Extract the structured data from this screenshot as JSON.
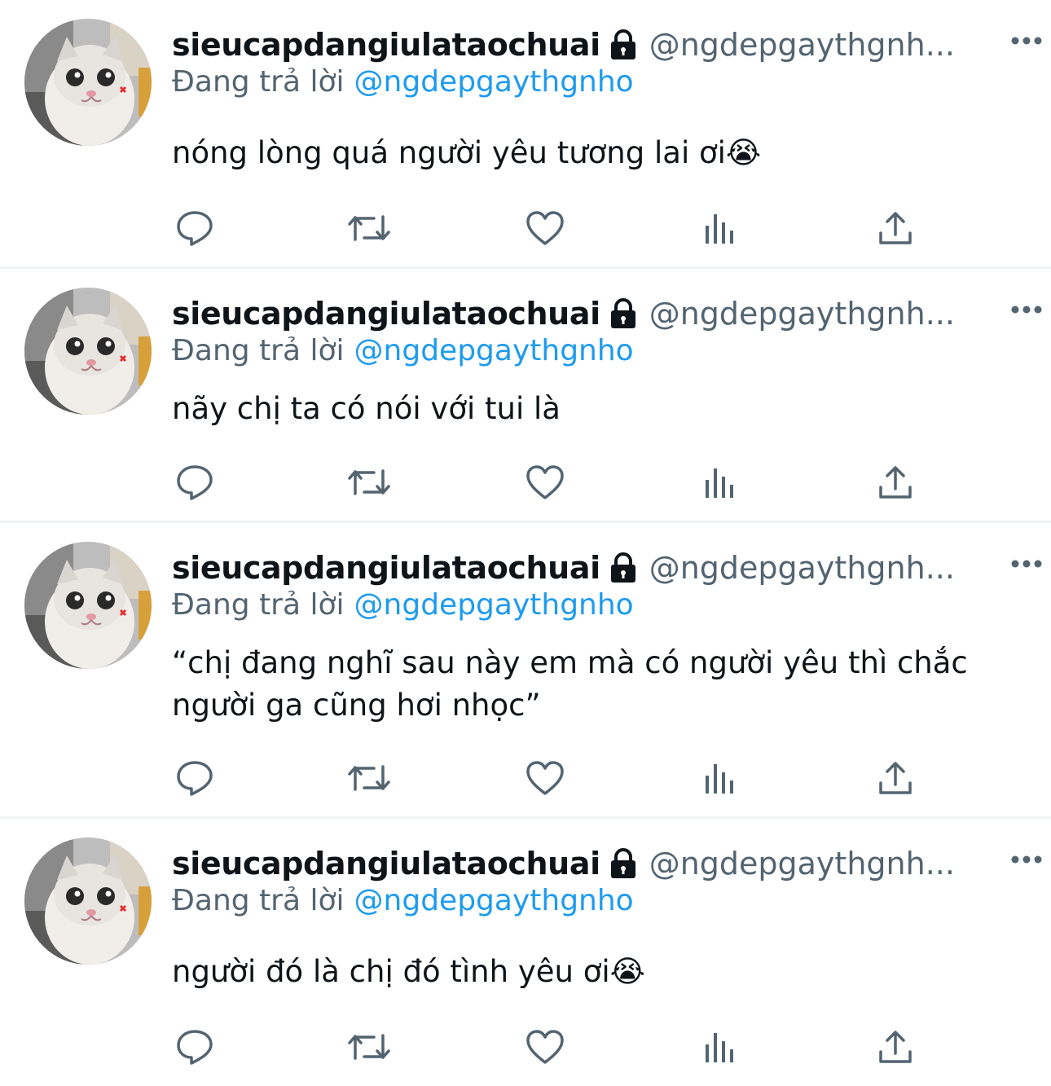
{
  "colors": {
    "text": "#0f1419",
    "secondary": "#536471",
    "link": "#1d9bf0",
    "divider": "#eff3f4"
  },
  "tweets": [
    {
      "display_name": "sieucapdangiulataochuai",
      "handle": "@ngdepgaythgnh...",
      "reply_prefix": "Đang trả lời",
      "reply_to": "@ngdepgaythgnho",
      "text": "nóng lòng quá người yêu tương lai ơi😭"
    },
    {
      "display_name": "sieucapdangiulataochuai",
      "handle": "@ngdepgaythgnh...",
      "reply_prefix": "Đang trả lời",
      "reply_to": "@ngdepgaythgnho",
      "text": "nãy chị ta có nói với tui là"
    },
    {
      "display_name": "sieucapdangiulataochuai",
      "handle": "@ngdepgaythgnh...",
      "reply_prefix": "Đang trả lời",
      "reply_to": "@ngdepgaythgnho",
      "text": "“chị đang nghĩ sau này em mà có người yêu thì chắc người ga cũng hơi nhọc”"
    },
    {
      "display_name": "sieucapdangiulataochuai",
      "handle": "@ngdepgaythgnh...",
      "reply_prefix": "Đang trả lời",
      "reply_to": "@ngdepgaythgnho",
      "text": "người đó là chị đó tình yêu ơi😭"
    }
  ],
  "icons": {
    "lock": "lock-icon",
    "more": "more-icon",
    "reply": "reply-icon",
    "retweet": "retweet-icon",
    "like": "like-icon",
    "views": "views-icon",
    "share": "share-icon"
  }
}
